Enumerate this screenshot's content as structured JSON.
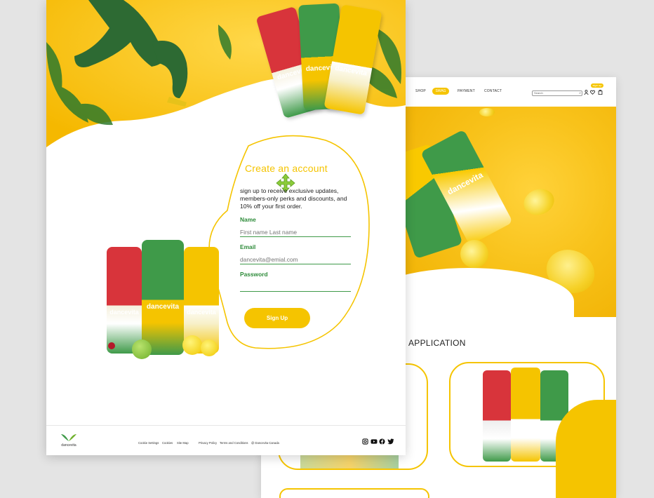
{
  "back_page": {
    "nav": {
      "links": [
        "SHOP",
        "SWAG",
        "PAYMENT",
        "CONTACT"
      ],
      "signup_pill": "sign up",
      "search_placeholder": "Search"
    },
    "application_title": "APPLICATION",
    "brand_name": "dancevita"
  },
  "front_page": {
    "brand_name": "dancevita",
    "form": {
      "title": "Create an account",
      "intro": "sign up to receive exclusive updates, members-only perks and discounts, and 10% off your first order.",
      "name_label": "Name",
      "name_placeholder": "First name Last name",
      "email_label": "Email",
      "email_placeholder": "dancevita@emial.com",
      "password_label": "Password",
      "password_value": "",
      "submit_label": "Sign Up"
    },
    "footer": {
      "logo_text": "dancevita",
      "links": [
        "Cookie Settings",
        "Cookies",
        "Site Map",
        "Privacy Policy",
        "Terms and Conditions",
        "@ Dancevita Canada"
      ],
      "social": [
        "instagram-icon",
        "youtube-icon",
        "facebook-icon",
        "twitter-icon"
      ]
    }
  },
  "colors": {
    "brand_yellow": "#f5c400",
    "brand_green": "#3f9a49",
    "can_red": "#d8343b",
    "background": "#e4e4e4"
  }
}
